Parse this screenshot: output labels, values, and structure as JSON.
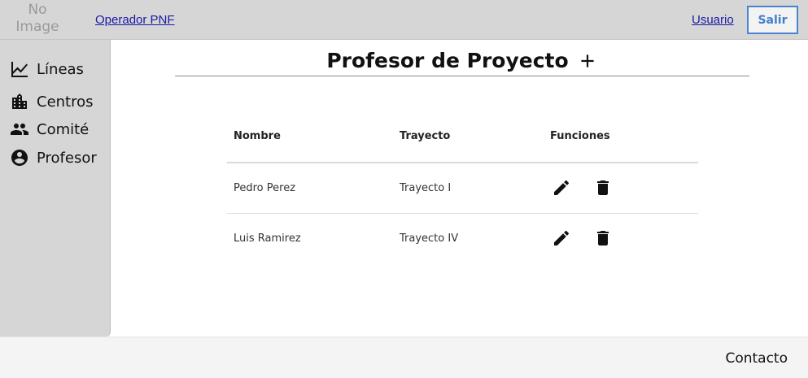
{
  "header": {
    "logo_text": "No Image",
    "brand_link": "Operador PNF",
    "user_link": "Usuario",
    "logout_label": "Salir"
  },
  "sidebar": {
    "items": [
      {
        "label": "Líneas",
        "icon": "chart-line-icon"
      },
      {
        "label": "Centros",
        "icon": "city-icon"
      },
      {
        "label": "Comité",
        "icon": "people-icon"
      },
      {
        "label": "Profesor",
        "icon": "account-circle-icon"
      }
    ]
  },
  "main": {
    "title": "Profesor de Proyecto",
    "table": {
      "headers": [
        "Nombre",
        "Trayecto",
        "Funciones"
      ],
      "rows": [
        {
          "nombre": "Pedro Perez",
          "trayecto": "Trayecto I"
        },
        {
          "nombre": "Luis Ramirez",
          "trayecto": "Trayecto IV"
        }
      ]
    }
  },
  "footer": {
    "contact_label": "Contacto"
  },
  "colors": {
    "header_bg": "#d6d6d6",
    "sidebar_bg": "#d6d6d6",
    "logout_accent": "#4a86d0",
    "link": "#1a1aa6",
    "footer_bg": "#f4f4f4"
  }
}
